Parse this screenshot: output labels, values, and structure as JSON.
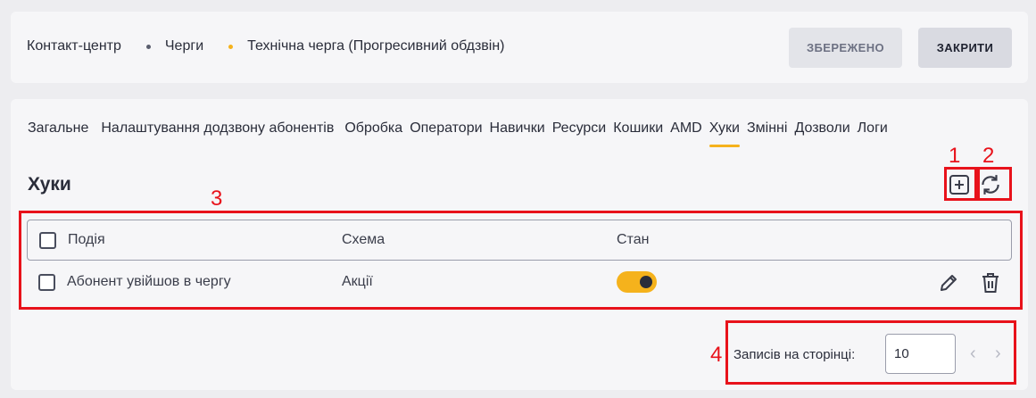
{
  "breadcrumb": {
    "items": [
      "Контакт-центр",
      "Черги",
      "Технічна черга (Прогресивний обдзвін)"
    ]
  },
  "header": {
    "saved_label": "ЗБЕРЕЖЕНО",
    "close_label": "ЗАКРИТИ"
  },
  "tabs": [
    {
      "label": "Загальне"
    },
    {
      "label": "Налаштування додзвону абонентів"
    },
    {
      "label": "Обробка"
    },
    {
      "label": "Оператори"
    },
    {
      "label": "Навички"
    },
    {
      "label": "Ресурси"
    },
    {
      "label": "Кошики"
    },
    {
      "label": "AMD"
    },
    {
      "label": "Хуки",
      "active": true
    },
    {
      "label": "Змінні"
    },
    {
      "label": "Дозволи"
    },
    {
      "label": "Логи"
    }
  ],
  "section": {
    "title": "Хуки"
  },
  "table": {
    "columns": [
      "Подія",
      "Схема",
      "Стан"
    ],
    "rows": [
      {
        "event": "Абонент увійшов в чергу",
        "schema": "Акції",
        "state_on": true
      }
    ]
  },
  "pagination": {
    "label": "Записів на сторінці:",
    "value": "10"
  },
  "annotations": [
    "1",
    "2",
    "3",
    "4"
  ],
  "colors": {
    "accent": "#f5b21c",
    "annotation": "#e8121b"
  },
  "icons": [
    "add-icon",
    "refresh-icon",
    "edit-icon",
    "delete-icon",
    "chevron-left-icon",
    "chevron-right-icon"
  ]
}
